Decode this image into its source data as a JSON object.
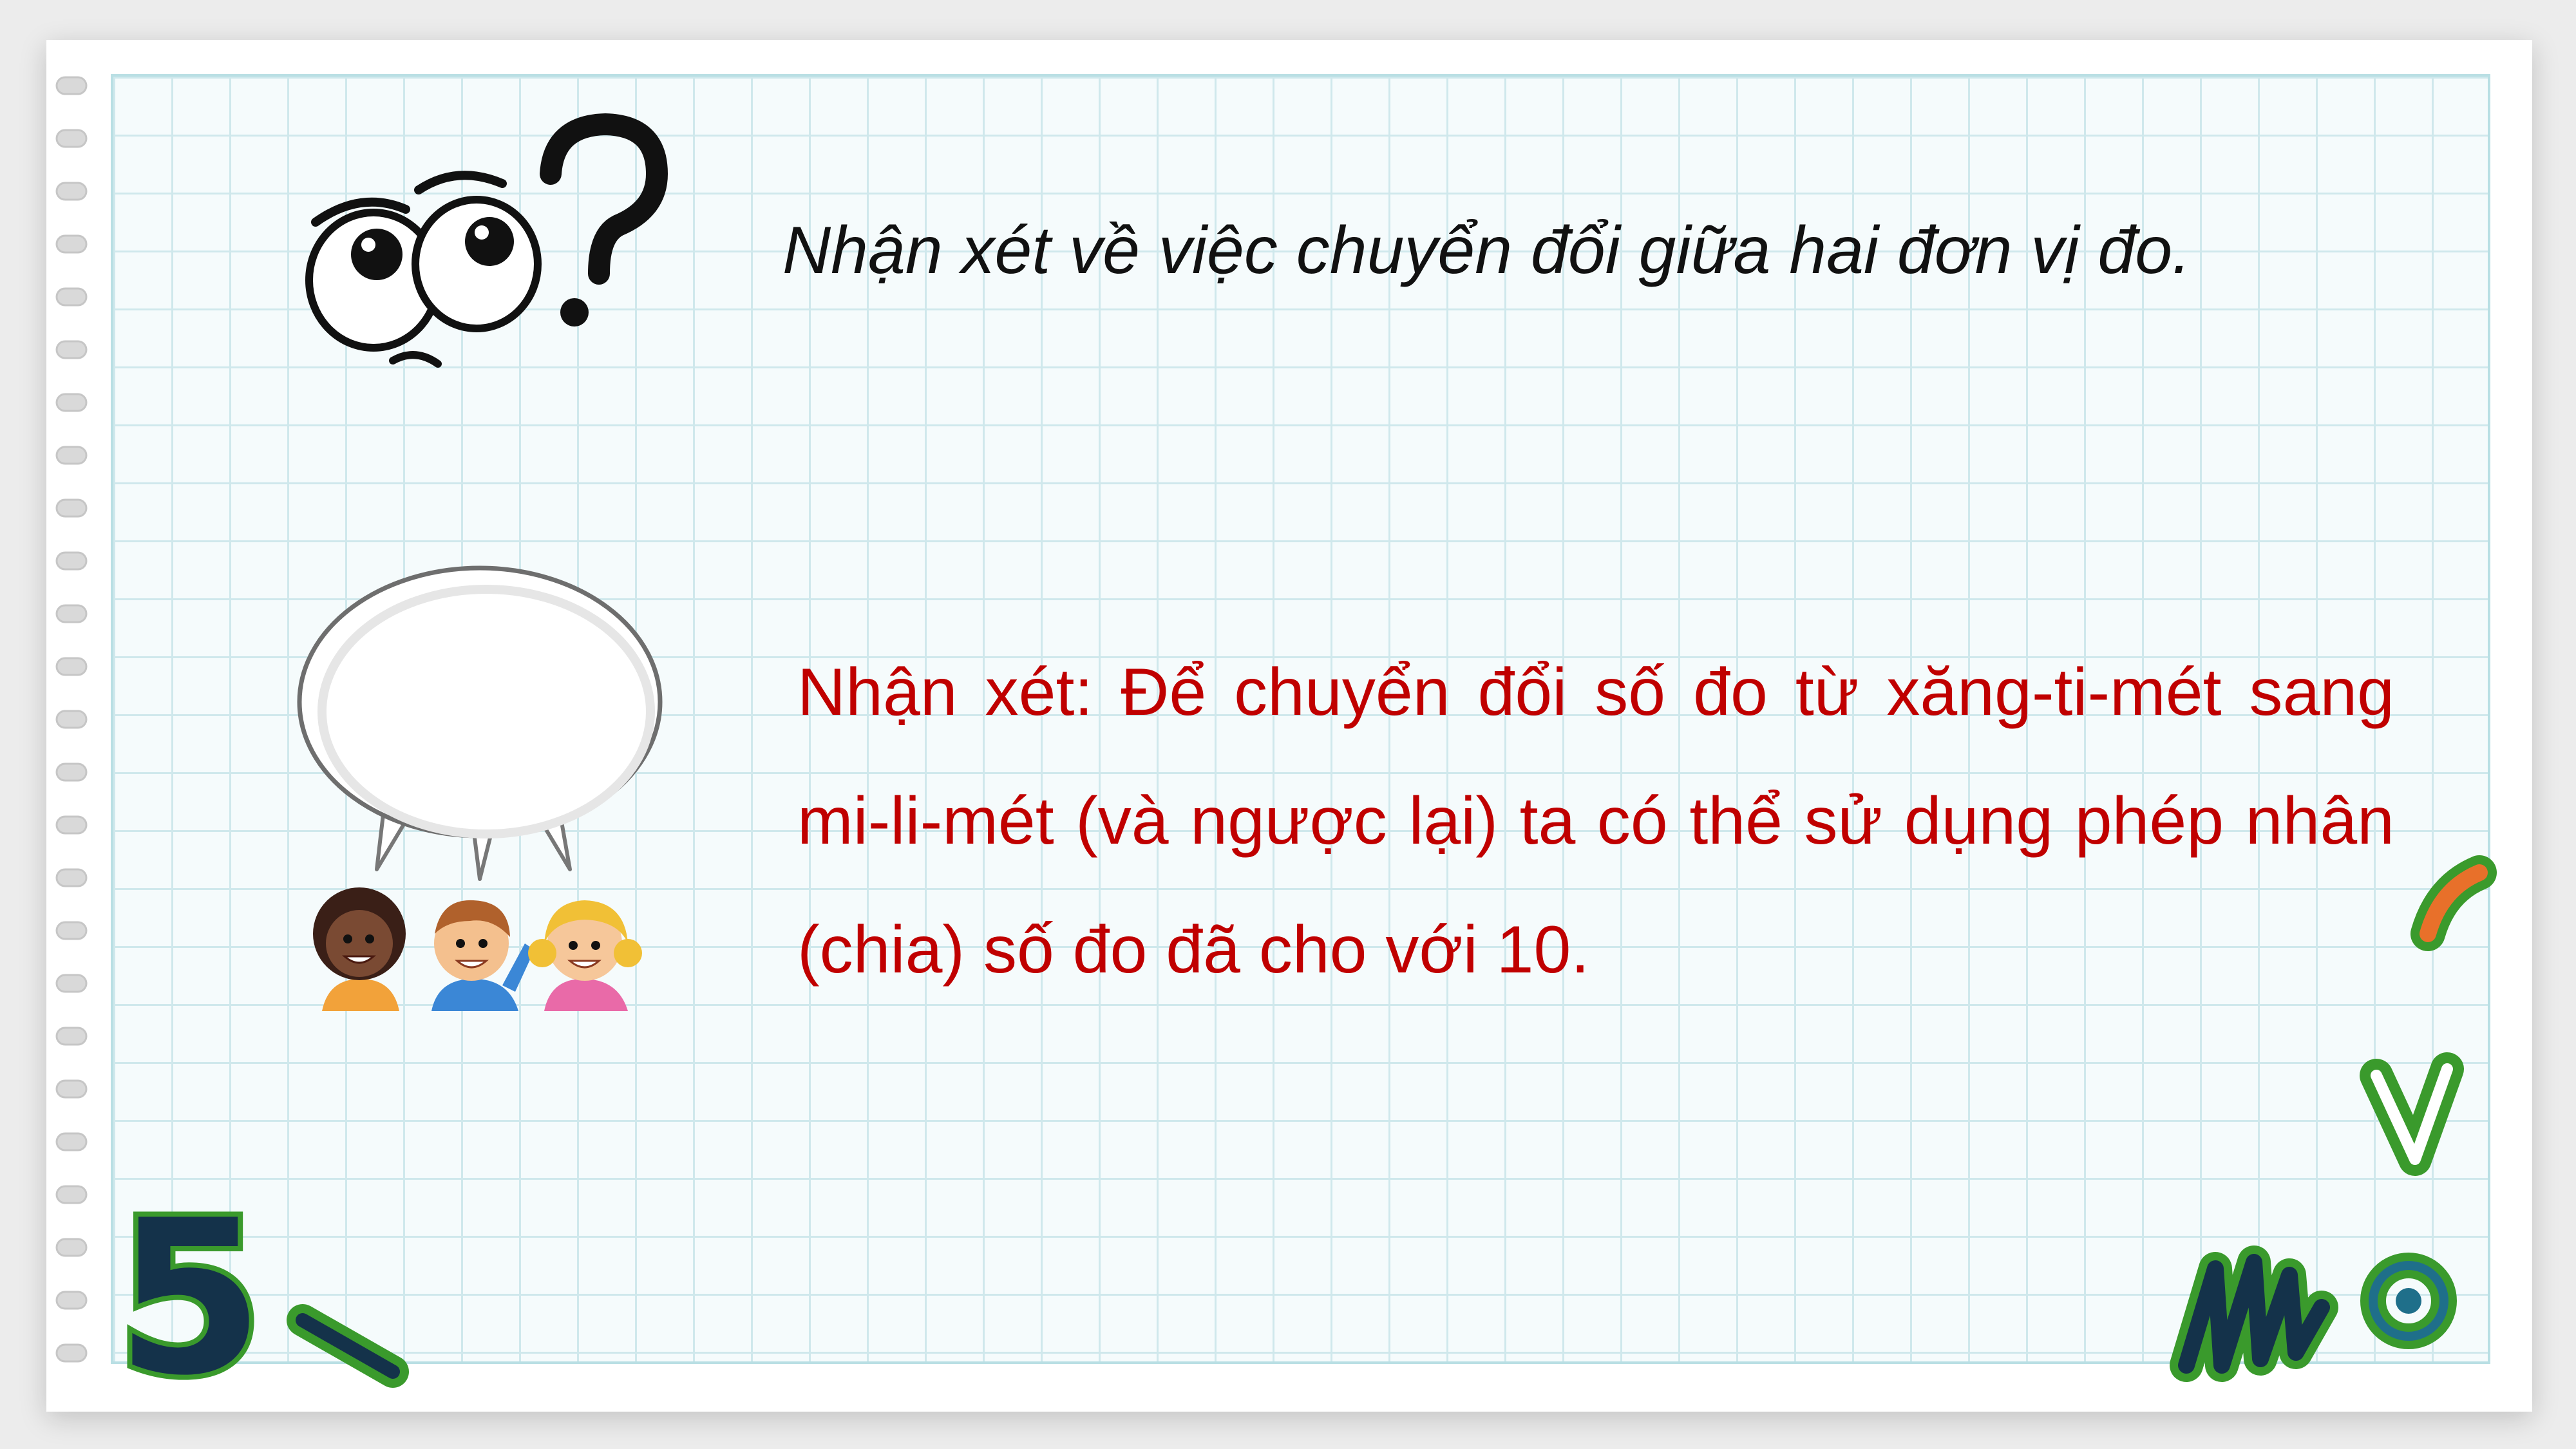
{
  "slide": {
    "question": "Nhận xét về việc chuyển đổi giữa hai đơn vị đo.",
    "remark": "Nhận xét: Để chuyển đổi số đo từ xăng-ti-mét sang mi-li-mét (và ngược lại) ta có thể sử dụng phép nhân (chia) số đo đã cho với 10.",
    "decor_digit": "5"
  },
  "colors": {
    "grid_line": "#cfe8ec",
    "remark_text": "#c00000",
    "decor_green": "#3a9a2c",
    "decor_navy": "#14324a",
    "decor_orange": "#e8702a"
  },
  "icons": [
    "thinking-eyes-question-icon",
    "speech-bubble",
    "kids-illustration"
  ]
}
